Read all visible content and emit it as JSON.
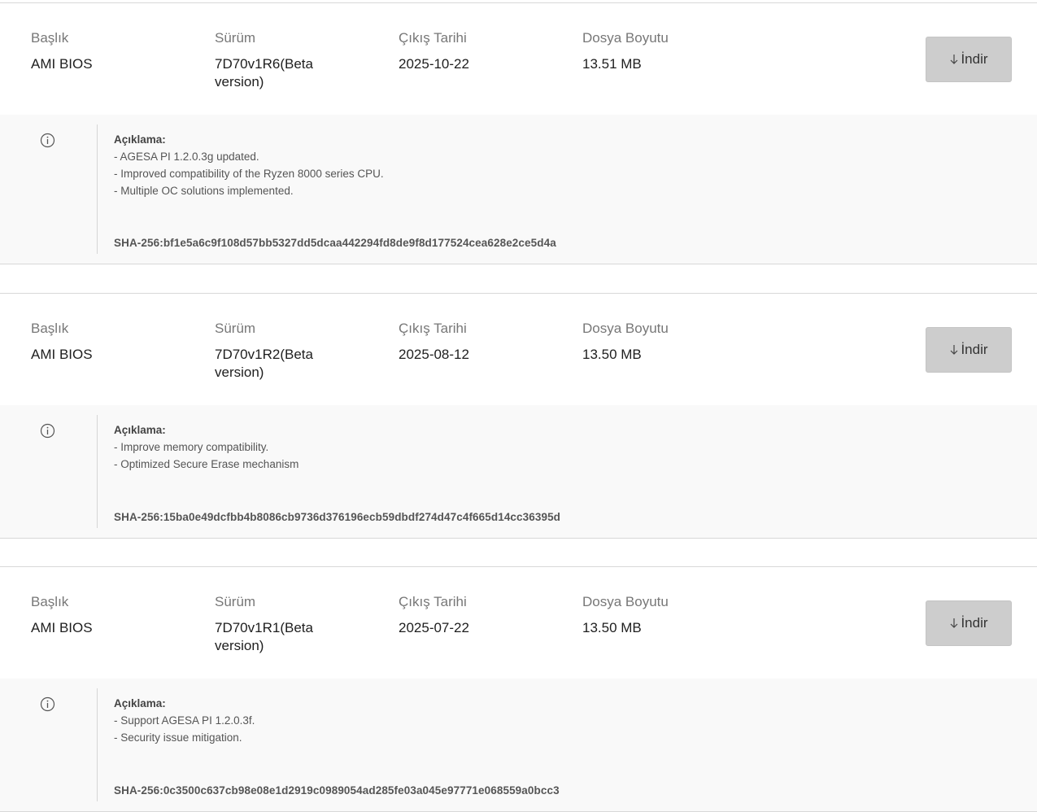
{
  "headers": {
    "title": "Başlık",
    "version": "Sürüm",
    "release_date": "Çıkış Tarihi",
    "file_size": "Dosya Boyutu"
  },
  "download_label": "İndir",
  "description_label": "Açıklama:",
  "icons": {
    "info": "info-circle-icon",
    "download": "arrow-down-icon"
  },
  "colors": {
    "button_bg": "#cdcdcd",
    "desc_bg": "#f9f9f9",
    "border": "#d8d8d8"
  },
  "entries": [
    {
      "title": "AMI BIOS",
      "version": "7D70v1R6(Beta version)",
      "release_date": "2025-10-22",
      "file_size": "13.51 MB",
      "notes": [
        "- AGESA PI 1.2.0.3g updated.",
        "- Improved compatibility of the Ryzen 8000 series CPU.",
        "- Multiple OC solutions implemented."
      ],
      "sha": "SHA-256:bf1e5a6c9f108d57bb5327dd5dcaa442294fd8de9f8d177524cea628e2ce5d4a"
    },
    {
      "title": "AMI BIOS",
      "version": "7D70v1R2(Beta version)",
      "release_date": "2025-08-12",
      "file_size": "13.50 MB",
      "notes": [
        "- Improve memory compatibility.",
        "- Optimized Secure Erase mechanism"
      ],
      "sha": "SHA-256:15ba0e49dcfbb4b8086cb9736d376196ecb59dbdf274d47c4f665d14cc36395d"
    },
    {
      "title": "AMI BIOS",
      "version": "7D70v1R1(Beta version)",
      "release_date": "2025-07-22",
      "file_size": "13.50 MB",
      "notes": [
        "- Support AGESA PI 1.2.0.3f.",
        "- Security issue mitigation."
      ],
      "sha": "SHA-256:0c3500c637cb98e08e1d2919c0989054ad285fe03a045e97771e068559a0bcc3"
    }
  ]
}
